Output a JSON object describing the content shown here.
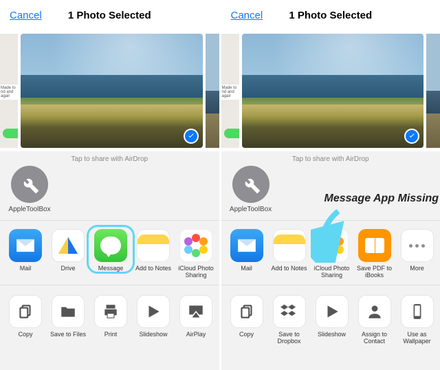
{
  "left": {
    "cancel": "Cancel",
    "title": "1 Photo Selected",
    "airdrop_hint": "Tap to share with AirDrop",
    "airdrop_contact": "AppleToolBox",
    "apps": [
      {
        "key": "mail",
        "label": "Mail"
      },
      {
        "key": "drive",
        "label": "Drive"
      },
      {
        "key": "message",
        "label": "Message",
        "highlighted": true
      },
      {
        "key": "notes",
        "label": "Add to Notes"
      },
      {
        "key": "icloud",
        "label": "iCloud Photo Sharing"
      }
    ],
    "actions": [
      {
        "key": "copy",
        "label": "Copy"
      },
      {
        "key": "savefiles",
        "label": "Save to Files"
      },
      {
        "key": "print",
        "label": "Print"
      },
      {
        "key": "slideshow",
        "label": "Slideshow"
      },
      {
        "key": "airplay",
        "label": "AirPlay"
      }
    ]
  },
  "right": {
    "cancel": "Cancel",
    "title": "1 Photo Selected",
    "airdrop_hint": "Tap to share with AirDrop",
    "airdrop_contact": "AppleToolBox",
    "annotation": "Message App Missing",
    "apps": [
      {
        "key": "mail",
        "label": "Mail"
      },
      {
        "key": "notes",
        "label": "Add to Notes"
      },
      {
        "key": "icloud",
        "label": "iCloud Photo Sharing"
      },
      {
        "key": "ibooks",
        "label": "Save PDF to iBooks"
      },
      {
        "key": "more",
        "label": "More"
      }
    ],
    "actions": [
      {
        "key": "copy",
        "label": "Copy"
      },
      {
        "key": "dropbox",
        "label": "Save to Dropbox"
      },
      {
        "key": "slideshow",
        "label": "Slideshow"
      },
      {
        "key": "assign",
        "label": "Assign to Contact"
      },
      {
        "key": "wallpaper",
        "label": "Use as Wallpaper"
      }
    ]
  }
}
